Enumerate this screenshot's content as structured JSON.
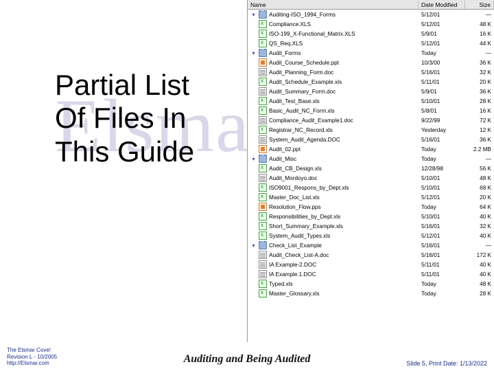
{
  "watermark": "Elsma",
  "heading_l1": "Partial List",
  "heading_l2": "Of Files In",
  "heading_l3": "This Guide",
  "cols": {
    "name": "Name",
    "date": "Date Modified",
    "size": "Size"
  },
  "tree": [
    {
      "kind": "folder",
      "level": 0,
      "open": true,
      "name": "Auditing-ISO_1994_Forms",
      "date": "5/12/01",
      "size": "—"
    },
    {
      "kind": "file",
      "level": 1,
      "icon": "xls",
      "name": "Compliance.XLS",
      "date": "5/12/01",
      "size": "48 K"
    },
    {
      "kind": "file",
      "level": 1,
      "icon": "xls",
      "name": "ISO-199_X-Functional_Matrix.XLS",
      "date": "5/9/01",
      "size": "16 K"
    },
    {
      "kind": "file",
      "level": 1,
      "icon": "xls",
      "name": "QS_Req.XLS",
      "date": "5/12/01",
      "size": "44 K"
    },
    {
      "kind": "folder",
      "level": 0,
      "open": true,
      "name": "Audit_Forms",
      "date": "Today",
      "size": "—"
    },
    {
      "kind": "file",
      "level": 1,
      "icon": "ppt",
      "name": "Audit_Course_Schedule.ppt",
      "date": "10/3/00",
      "size": "36 K"
    },
    {
      "kind": "file",
      "level": 1,
      "icon": "doc",
      "name": "Audit_Planning_Form.doc",
      "date": "5/16/01",
      "size": "32 K"
    },
    {
      "kind": "file",
      "level": 1,
      "icon": "xls",
      "name": "Audit_Schedule_Example.xls",
      "date": "5/11/01",
      "size": "20 K"
    },
    {
      "kind": "file",
      "level": 1,
      "icon": "doc",
      "name": "Audit_Summary_Form.doc",
      "date": "5/9/01",
      "size": "36 K"
    },
    {
      "kind": "file",
      "level": 1,
      "icon": "xls",
      "name": "Audit_Test_Base.xls",
      "date": "5/10/01",
      "size": "28 K"
    },
    {
      "kind": "file",
      "level": 1,
      "icon": "xls",
      "name": "Basic_Audit_NC_Form.xls",
      "date": "5/8/01",
      "size": "16 K"
    },
    {
      "kind": "file",
      "level": 1,
      "icon": "doc",
      "name": "Compliance_Audit_Example1.doc",
      "date": "9/22/99",
      "size": "72 K"
    },
    {
      "kind": "file",
      "level": 1,
      "icon": "xls",
      "name": "Registrar_NC_Record.xls",
      "date": "Yesterday",
      "size": "12 K"
    },
    {
      "kind": "file",
      "level": 1,
      "icon": "doc",
      "name": "System_Audit_Agenda.DOC",
      "date": "5/16/01",
      "size": "36 K"
    },
    {
      "kind": "file",
      "level": 0,
      "icon": "ppt",
      "name": "Audit_02.ppt",
      "date": "Today",
      "size": "2.2 MB"
    },
    {
      "kind": "folder",
      "level": 0,
      "open": true,
      "name": "Audit_Misc",
      "date": "Today",
      "size": "—"
    },
    {
      "kind": "file",
      "level": 1,
      "icon": "xls",
      "name": "Audit_CB_Design.xls",
      "date": "12/28/98",
      "size": "56 K"
    },
    {
      "kind": "file",
      "level": 1,
      "icon": "doc",
      "name": "Audit_Mordoyo.doc",
      "date": "5/10/01",
      "size": "48 K"
    },
    {
      "kind": "file",
      "level": 1,
      "icon": "xls",
      "name": "ISO9001_Respons_by_Dept.xls",
      "date": "5/10/01",
      "size": "68 K"
    },
    {
      "kind": "file",
      "level": 1,
      "icon": "xls",
      "name": "Master_Doc_List.xls",
      "date": "5/12/01",
      "size": "20 K"
    },
    {
      "kind": "file",
      "level": 1,
      "icon": "ppt",
      "name": "Resolution_Flow.pps",
      "date": "Today",
      "size": "64 K"
    },
    {
      "kind": "file",
      "level": 1,
      "icon": "xls",
      "name": "Responsibilities_by_Dept.xls",
      "date": "5/10/01",
      "size": "40 K"
    },
    {
      "kind": "file",
      "level": 1,
      "icon": "xls",
      "name": "Short_Summary_Example.xls",
      "date": "5/16/01",
      "size": "32 K"
    },
    {
      "kind": "file",
      "level": 1,
      "icon": "xls",
      "name": "System_Audit_Types.xls",
      "date": "5/12/01",
      "size": "40 K"
    },
    {
      "kind": "folder",
      "level": 0,
      "open": true,
      "name": "Check_List_Example",
      "date": "5/16/01",
      "size": "—"
    },
    {
      "kind": "file",
      "level": 1,
      "icon": "doc",
      "name": "Audit_Check_List-A.doc",
      "date": "5/16/01",
      "size": "172 K"
    },
    {
      "kind": "file",
      "level": 1,
      "icon": "doc",
      "name": "IA Example-2.DOC",
      "date": "5/11/01",
      "size": "40 K"
    },
    {
      "kind": "file",
      "level": 1,
      "icon": "doc",
      "name": "IA Example.1.DOC",
      "date": "5/11/01",
      "size": "40 K"
    },
    {
      "kind": "file",
      "level": 1,
      "icon": "xls",
      "name": "Typed.xls",
      "date": "Today",
      "size": "48 K"
    },
    {
      "kind": "file",
      "level": 0,
      "icon": "xls",
      "name": "Master_Glossary.xls",
      "date": "Today",
      "size": "28 K"
    }
  ],
  "footer": {
    "left_l1": "The Elsmar Cove!",
    "left_l2": "Revision L - 10/2005",
    "left_l3": "http://Elsmar.com",
    "center": "Auditing and Being Audited",
    "right": "Slide 5,  Print Date: 1/13/2022"
  }
}
